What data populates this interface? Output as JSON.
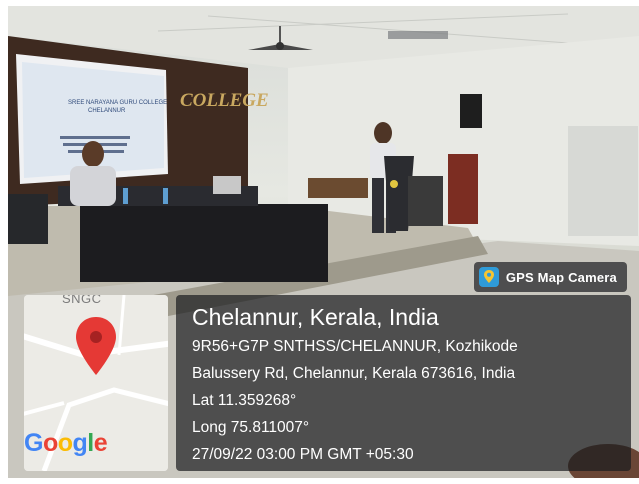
{
  "photo": {
    "wall_sign": "COLLEGE",
    "projector_slide": {
      "title_line1": "SREE NARAYANA GURU COLLEGE",
      "title_line2": "CHELANNUR"
    }
  },
  "badge": {
    "label": "GPS Map Camera",
    "icon": "map-pin-app-icon"
  },
  "map": {
    "street_label": "SNGC",
    "brand": {
      "letters": [
        "G",
        "o",
        "o",
        "g",
        "l",
        "e"
      ],
      "colors": [
        "#4285f4",
        "#ea4335",
        "#fbbc05",
        "#4285f4",
        "#34a853",
        "#ea4335"
      ]
    },
    "pin_color": "#e53935"
  },
  "location": {
    "place": "Chelannur, Kerala, India",
    "address_line1": "9R56+G7P SNTHSS/CHELANNUR, Kozhikode",
    "address_line2": "Balussery Rd, Chelannur, Kerala 673616, India",
    "lat": "Lat 11.359268°",
    "long": "Long 75.811007°",
    "datetime": "27/09/22 03:00 PM GMT +05:30"
  }
}
